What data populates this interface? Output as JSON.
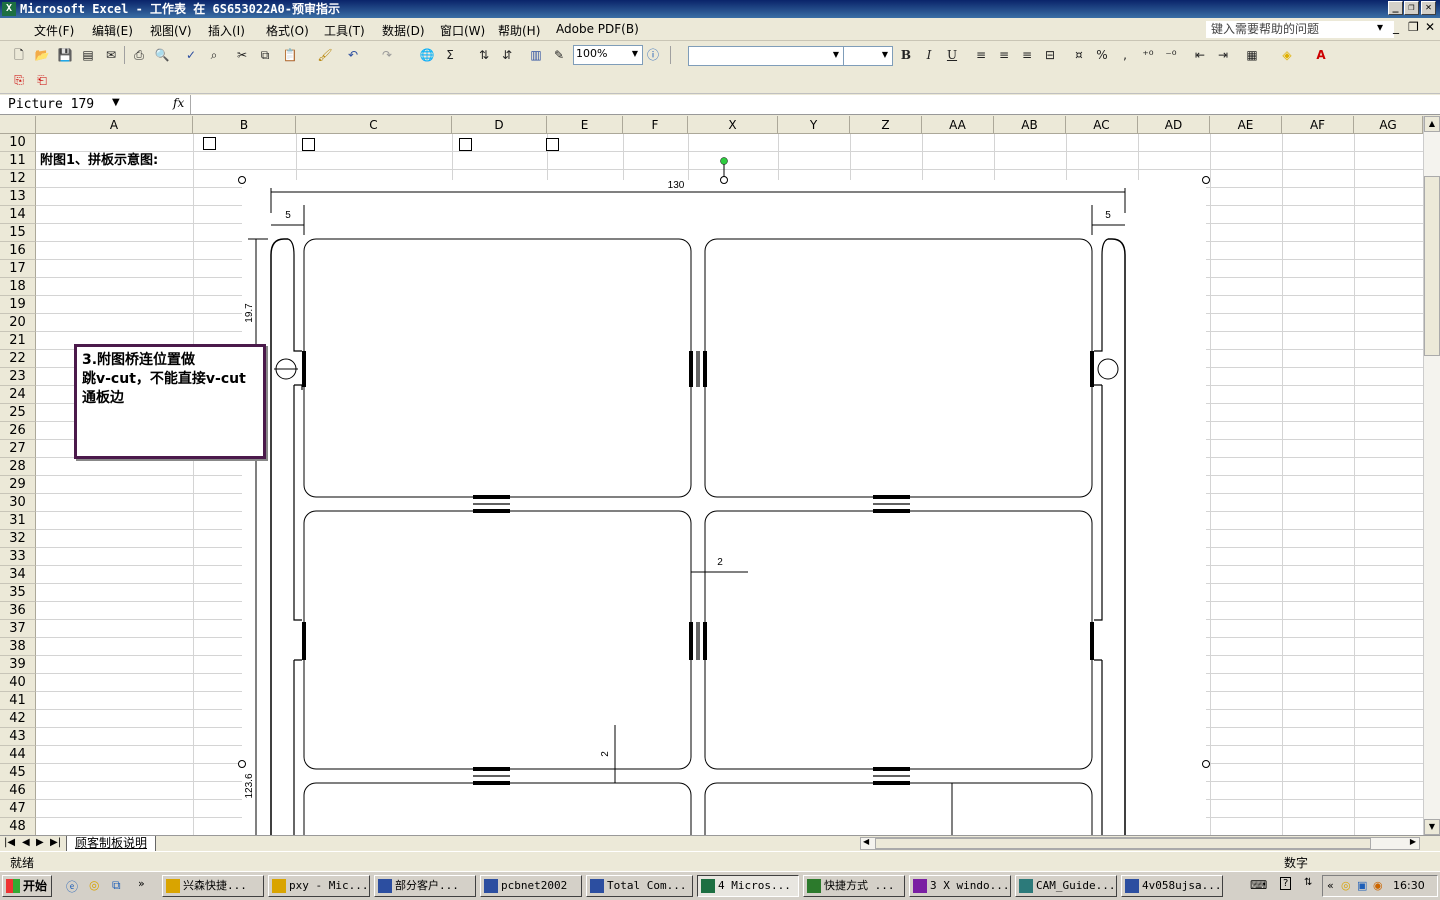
{
  "window": {
    "title": "Microsoft Excel - 工作表 在 6S653022A0-预审指示",
    "min_btn": "_",
    "restore_btn": "❐",
    "close_btn": "✕",
    "app_icon": "excel-icon"
  },
  "menu": {
    "items": [
      "文件(F)",
      "编辑(E)",
      "视图(V)",
      "插入(I)",
      "格式(O)",
      "工具(T)",
      "数据(D)",
      "窗口(W)",
      "帮助(H)",
      "Adobe PDF(B)"
    ],
    "help_placeholder": "键入需要帮助的问题",
    "doc_min": "_",
    "doc_restore": "❐",
    "doc_close": "✕"
  },
  "toolbar": {
    "zoom": "100%",
    "font_name": "",
    "font_size": "",
    "bold": "B",
    "italic": "I",
    "underline": "U",
    "percent": "%",
    "comma": ",",
    "sigma": "Σ",
    "font_color_glyph": "A"
  },
  "formula_bar": {
    "name_box": "Picture 179",
    "fx": "fx",
    "formula": ""
  },
  "sheet": {
    "columns": [
      "A",
      "B",
      "C",
      "D",
      "E",
      "F",
      "X",
      "Y",
      "Z",
      "AA",
      "AB",
      "AC",
      "AD",
      "AE",
      "AF",
      "AG"
    ],
    "rows": [
      "10",
      "11",
      "12",
      "13",
      "14",
      "15",
      "16",
      "17",
      "18",
      "19",
      "20",
      "21",
      "22",
      "23",
      "24",
      "25",
      "26",
      "27",
      "28",
      "29",
      "30",
      "31",
      "32",
      "33",
      "34",
      "35",
      "36",
      "37",
      "38",
      "39",
      "40",
      "41",
      "42",
      "43",
      "44",
      "45",
      "46",
      "47",
      "48"
    ],
    "cell_a11": "附图1、拼板示意图:"
  },
  "drawing": {
    "dim_width": "130",
    "dim_left_margin": "5",
    "dim_right_margin": "5",
    "dim_height_top": "19.7",
    "dim_height_total": "123.6",
    "dim_gap_h": "2",
    "dim_gap_v": "2"
  },
  "callout": {
    "line1": "3.附图桥连位置做",
    "line2": "跳v-cut，不能直接v-cut",
    "line3": "通板边"
  },
  "sheet_tabs": {
    "active_tab": "顾客制板说明"
  },
  "status": {
    "left": "就绪",
    "num": "数字"
  },
  "taskbar": {
    "start": "开始",
    "tasks": [
      {
        "label": "兴森快捷...",
        "icon": "star-icon"
      },
      {
        "label": "pxy - Mic...",
        "icon": "outlook-icon"
      },
      {
        "label": "部分客户...",
        "icon": "word-icon"
      },
      {
        "label": "pcbnet2002",
        "icon": "globe-icon"
      },
      {
        "label": "Total Com...",
        "icon": "disk-icon"
      },
      {
        "label": "4 Micros...",
        "icon": "excel-icon"
      },
      {
        "label": "快捷方式 ...",
        "icon": "network-icon"
      },
      {
        "label": "3 X windo...",
        "icon": "x-icon"
      },
      {
        "label": "CAM_Guide...",
        "icon": "cam-icon"
      },
      {
        "label": "4v058ujsa...",
        "icon": "doc-icon"
      }
    ],
    "clock": "16:30"
  },
  "colors": {
    "title_start": "#0a246a",
    "title_end": "#3a6ea5",
    "callout_border": "#4b1a4b"
  }
}
